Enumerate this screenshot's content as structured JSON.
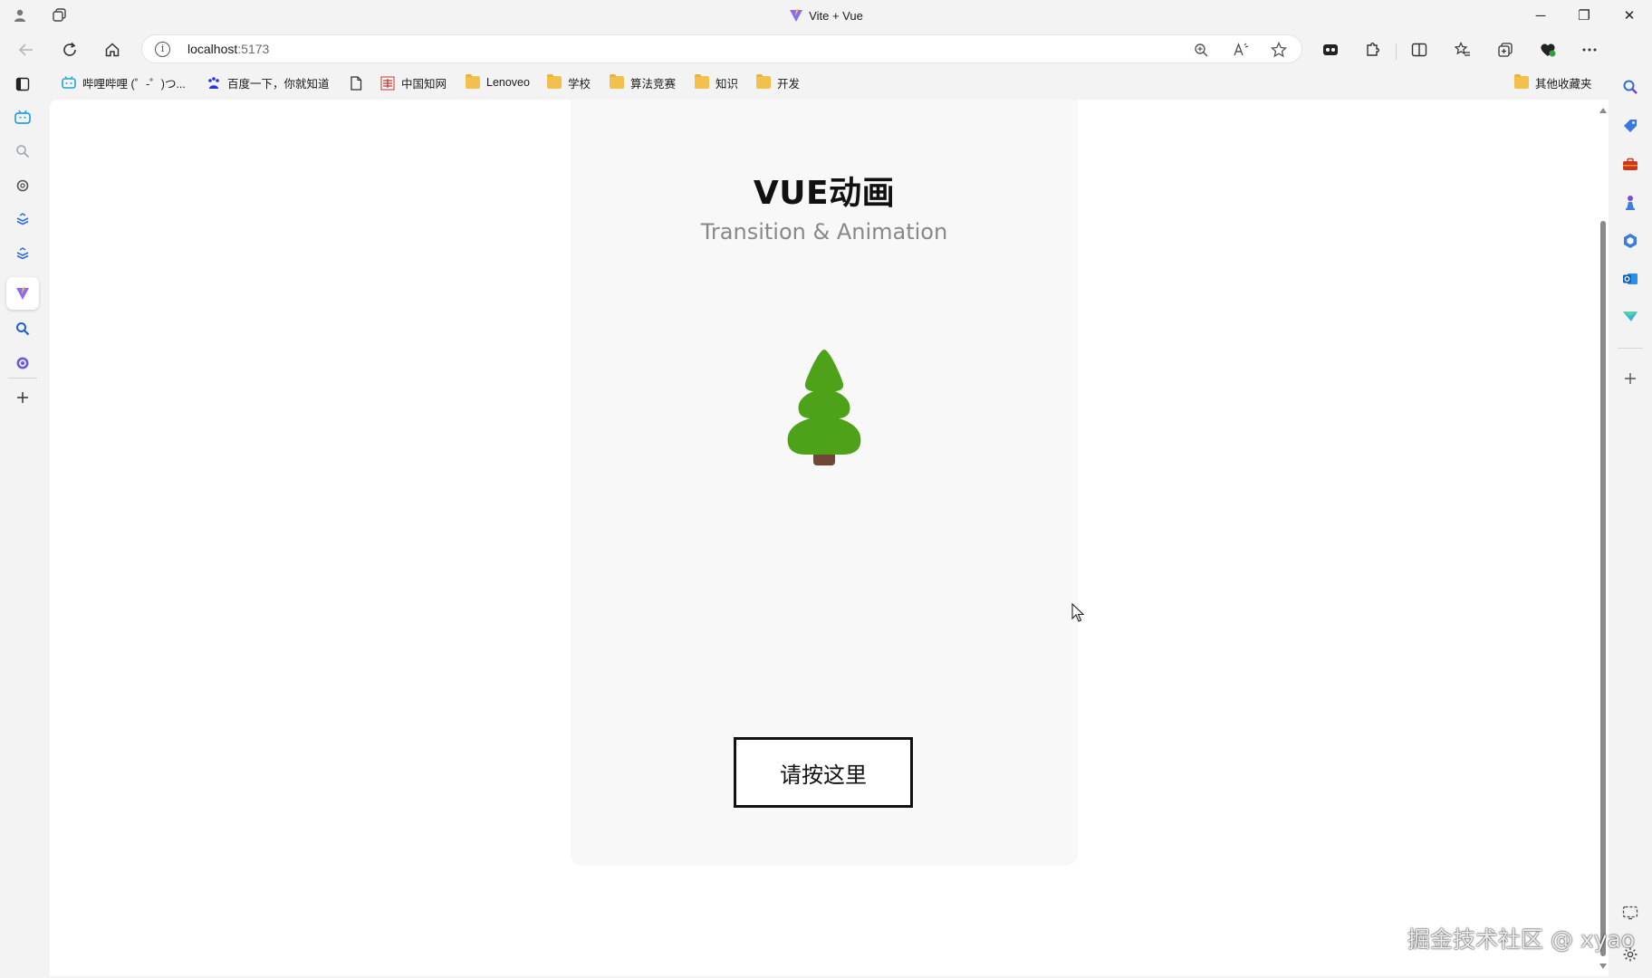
{
  "window": {
    "title": "Vite + Vue",
    "controls": {
      "minimize": "─",
      "restore": "❐",
      "close": "✕"
    }
  },
  "address_bar": {
    "host": "localhost",
    "port": ":5173"
  },
  "favorites": [
    {
      "label": "哔哩哔哩 (゜-゜)つ...",
      "icon": "bilibili-icon"
    },
    {
      "label": "百度一下，你就知道",
      "icon": "baidu-icon"
    },
    {
      "label": "",
      "icon": "page-icon"
    },
    {
      "label": "中国知网",
      "icon": "cnki-icon"
    },
    {
      "label": "Lenoveo",
      "icon": "folder-icon"
    },
    {
      "label": "学校",
      "icon": "folder-icon"
    },
    {
      "label": "算法竞赛",
      "icon": "folder-icon"
    },
    {
      "label": "知识",
      "icon": "folder-icon"
    },
    {
      "label": "开发",
      "icon": "folder-icon"
    }
  ],
  "other_favorites": "其他收藏夹",
  "page": {
    "title": "VUE动画",
    "subtitle": "Transition & Animation",
    "button_label": "请按这里"
  },
  "watermark": "掘金技术社区 @ xyao",
  "colors": {
    "tree_green": "#4ea21a",
    "tree_trunk": "#6e4737",
    "card_bg": "#f8f8f8",
    "chrome_bg": "#f3f3f3"
  }
}
